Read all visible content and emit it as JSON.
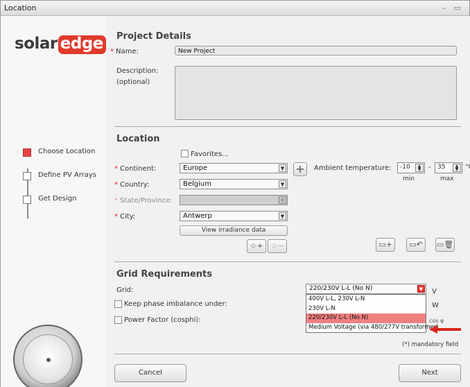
{
  "window": {
    "title": "Location",
    "controls": "– ▭"
  },
  "logo": {
    "part1": "solar",
    "part2": "edge"
  },
  "steps": [
    {
      "label": "Choose Location",
      "active": true
    },
    {
      "label": "Define PV Arrays",
      "active": false
    },
    {
      "label": "Get Design",
      "active": false
    }
  ],
  "project": {
    "title": "Project Details",
    "name_label": "Name:",
    "name_value": "New Project",
    "description_label_1": "Description:",
    "description_label_2": "(optional)"
  },
  "location": {
    "title": "Location",
    "favorites_label": "Favorites...",
    "continent_label": "Continent:",
    "continent_value": "Europe",
    "country_label": "Country:",
    "country_value": "Belgium",
    "state_label": "State/Province:",
    "state_value": "",
    "city_label": "City:",
    "city_value": "Antwerp",
    "irradiance_button": "View irradiance data",
    "ambient_label": "Ambient temperature:",
    "temp_min": "-10",
    "temp_max": "35",
    "temp_unit": "°C",
    "min_label": "min",
    "max_label": "max",
    "dash": "-"
  },
  "grid": {
    "title": "Grid Requirements",
    "grid_label": "Grid:",
    "grid_value": "220/230V L-L (No N)",
    "grid_unit": "V",
    "imbalance_label": "Keep phase imbalance under:",
    "imbalance_unit": "W",
    "pf_label": "Power Factor (cosphi):",
    "pf_unit": "cos φ",
    "options": [
      "400V L-L, 230V L-N",
      "230V L-N",
      "220/230V L-L (No N)",
      "Medium Voltage (via 480/277V transformer)"
    ],
    "selected_index": 2
  },
  "mandatory_note": "(*) mandatory field",
  "buttons": {
    "cancel": "Cancel",
    "next": "Next"
  },
  "colors": {
    "accent_red": "#e23a2b",
    "arrow_red": "#d9261c"
  }
}
